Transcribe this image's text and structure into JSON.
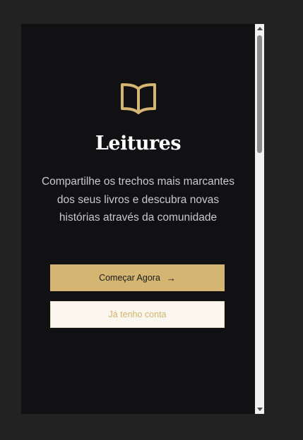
{
  "app": {
    "title": "Leitures",
    "tagline": "Compartilhe os trechos mais marcantes dos seus livros e descubra novas histórias através da comunidade"
  },
  "actions": {
    "start_label": "Começar Agora",
    "start_icon": "arrow-right-icon",
    "login_label": "Já tenho conta"
  },
  "icons": {
    "logo": "open-book-icon"
  },
  "colors": {
    "page_background": "#222222",
    "app_background": "#111114",
    "accent": "#d4b571",
    "accent_text": "#d2b26d",
    "secondary_button_bg": "#fbf7ee",
    "title": "#ffffff",
    "tagline": "#c9c9cf"
  }
}
